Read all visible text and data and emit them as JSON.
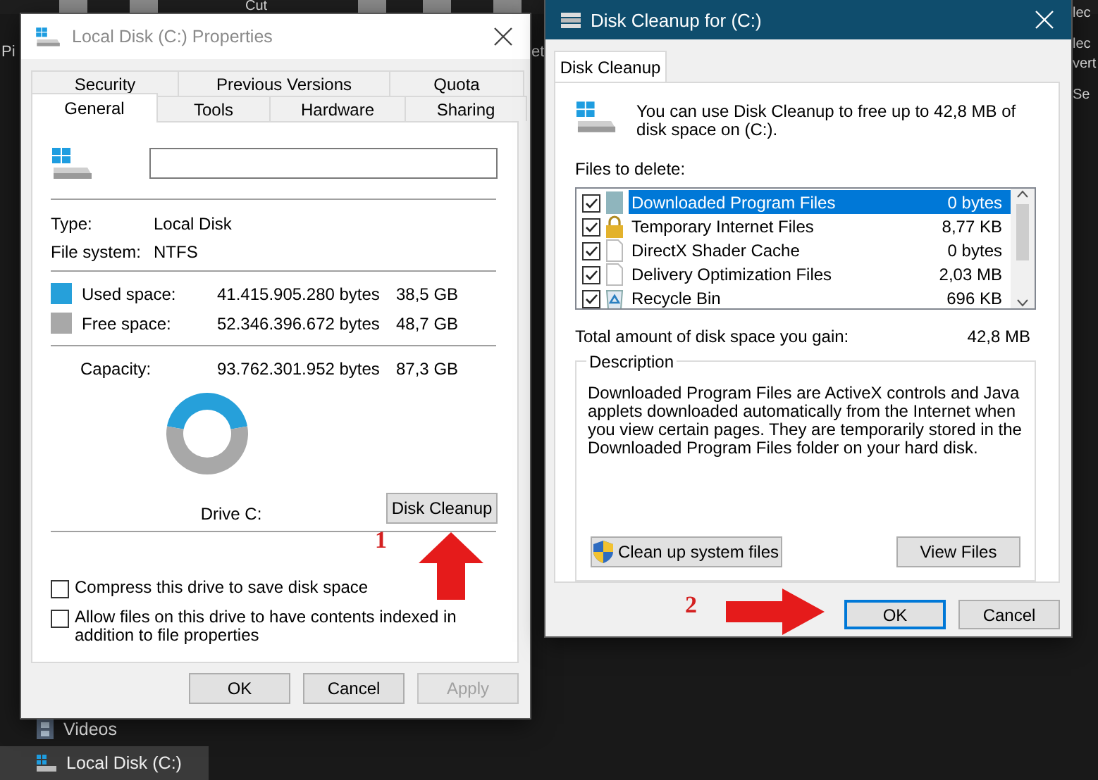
{
  "explorer": {
    "ribbon_labels": [
      "Cut"
    ],
    "edge_fragments": [
      "Pi",
      "et"
    ],
    "right_fragments": [
      "lec",
      "lec",
      "vert",
      "Se"
    ],
    "sidebar_items": [
      {
        "label": "Videos",
        "kind": "videos",
        "selected": false
      },
      {
        "label": "Local Disk (C:)",
        "kind": "drive",
        "selected": true
      }
    ]
  },
  "properties_dialog": {
    "title": "Local Disk (C:) Properties",
    "tab_rows": [
      [
        {
          "label": "Security",
          "selected": false
        },
        {
          "label": "Previous Versions",
          "selected": false
        },
        {
          "label": "Quota",
          "selected": false
        }
      ],
      [
        {
          "label": "General",
          "selected": true
        },
        {
          "label": "Tools",
          "selected": false
        },
        {
          "label": "Hardware",
          "selected": false
        },
        {
          "label": "Sharing",
          "selected": false
        }
      ]
    ],
    "info": [
      {
        "label": "Type:",
        "value": "Local Disk"
      },
      {
        "label": "File system:",
        "value": "NTFS"
      }
    ],
    "space": [
      {
        "label": "Used space:",
        "bytes": "41.415.905.280 bytes",
        "size": "38,5 GB",
        "color": "#26a0da"
      },
      {
        "label": "Free space:",
        "bytes": "52.346.396.672 bytes",
        "size": "48,7 GB",
        "color": "#a8a8a8"
      }
    ],
    "capacity": {
      "label": "Capacity:",
      "bytes": "93.762.301.952 bytes",
      "size": "87,3 GB"
    },
    "chart_data": {
      "type": "donut",
      "values": [
        44.17,
        55.83
      ]
    },
    "drive_label": "Drive C:",
    "cleanup_button": "Disk Cleanup",
    "options": [
      {
        "label": "Compress this drive to save disk space",
        "checked": false
      },
      {
        "label": "Allow files on this drive to have contents indexed in addition to file properties",
        "checked": false
      }
    ],
    "buttons": [
      {
        "label": "OK",
        "disabled": false
      },
      {
        "label": "Cancel",
        "disabled": false
      },
      {
        "label": "Apply",
        "disabled": true
      }
    ]
  },
  "cleanup_dialog": {
    "title": "Disk Cleanup for  (C:)",
    "tab": {
      "label": "Disk Cleanup",
      "selected": true
    },
    "intro": "You can use Disk Cleanup to free up to 42,8 MB of disk space on  (C:).",
    "files_label": "Files to delete:",
    "files": [
      {
        "name": "Downloaded Program Files",
        "size": "0 bytes",
        "checked": true,
        "selected": true,
        "kind": "folder"
      },
      {
        "name": "Temporary Internet Files",
        "size": "8,77 KB",
        "checked": true,
        "selected": false,
        "kind": "lock"
      },
      {
        "name": "DirectX Shader Cache",
        "size": "0 bytes",
        "checked": true,
        "selected": false,
        "kind": "page"
      },
      {
        "name": "Delivery Optimization Files",
        "size": "2,03 MB",
        "checked": true,
        "selected": false,
        "kind": "page"
      },
      {
        "name": "Recycle Bin",
        "size": "696 KB",
        "checked": true,
        "selected": false,
        "kind": "recycle"
      }
    ],
    "total_label": "Total amount of disk space you gain:",
    "total_value": "42,8 MB",
    "description_title": "Description",
    "description": "Downloaded Program Files are ActiveX controls and Java applets downloaded automatically from the Internet when you view certain pages. They are temporarily stored in the Downloaded Program Files folder on your hard disk.",
    "actions": [
      {
        "label": "Clean up system files",
        "kind": "shield"
      },
      {
        "label": "View Files",
        "kind": "plain"
      }
    ],
    "buttons": [
      {
        "label": "OK",
        "default": true
      },
      {
        "label": "Cancel",
        "default": false
      }
    ]
  },
  "annotations": [
    {
      "label": "1",
      "kind": "up"
    },
    {
      "label": "2",
      "kind": "right"
    }
  ]
}
